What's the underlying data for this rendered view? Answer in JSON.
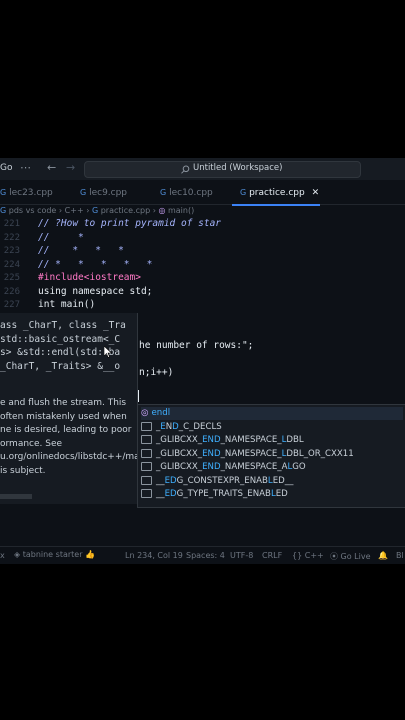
{
  "titlebar": {
    "menu": "Go",
    "more": "⋯",
    "back": "←",
    "forward": "→",
    "search": "Untitled (Workspace)"
  },
  "tabs": [
    {
      "label": "lec23.cpp"
    },
    {
      "label": "lec9.cpp"
    },
    {
      "label": "lec10.cpp"
    },
    {
      "label": "practice.cpp",
      "close": "✕"
    }
  ],
  "breadcrumb": {
    "root": "pds vs code",
    "lang": "C++",
    "file": "practice.cpp",
    "symbol": "main()"
  },
  "code": {
    "line_numbers": [
      "221",
      "222",
      "223",
      "224",
      "225",
      "226",
      "227"
    ],
    "lines": [
      "// ?How to print pyramid of star",
      "//     *",
      "//    *   *   *",
      "// *   *   *   *   *",
      "#include<iostream>",
      "using namespace std;",
      "int main()"
    ],
    "frag1": "he number of rows:\";",
    "frag2": "n;i++)"
  },
  "hover": {
    "sig": [
      "ass _CharT, class _Tra",
      "std::basic_ostream<_C",
      "s> &std::endl(std::ba",
      "_CharT, _Traits> &__o"
    ],
    "doc": [
      "e and flush the stream. This",
      "often mistakenly used when",
      "ne is desired, leading to poor",
      "ormance. See",
      "u.org/onlinedocs/libstdc++/ma",
      "is subject."
    ]
  },
  "suggest": [
    {
      "pre": "",
      "hl": "endl",
      "post": ""
    },
    {
      "pre": "_",
      "hl": "E",
      "mid": "N",
      "hl2": "D",
      "post": "_C_DECLS"
    },
    {
      "pre": "_GLIBCXX_",
      "hl": "END",
      "post": "_NAMESPACE_",
      "hl2": "L",
      "post2": "DBL"
    },
    {
      "pre": "_GLIBCXX_",
      "hl": "END",
      "post": "_NAMESPACE_",
      "hl2": "L",
      "post2": "DBL_OR_CXX11"
    },
    {
      "pre": "_GLIBCXX_",
      "hl": "END",
      "post": "_NAMESPACE_A",
      "hl2": "L",
      "post2": "GO"
    },
    {
      "pre": "__",
      "hl": "ED",
      "post": "G_CONSTEXPR_ENAB",
      "hl2": "L",
      "post2": "ED__"
    },
    {
      "pre": "__",
      "hl": "ED",
      "post": "G_TYPE_TRAITS_ENAB",
      "hl2": "L",
      "post2": "ED"
    }
  ],
  "status": {
    "left": "x",
    "tabnine": "tabnine starter",
    "position": "Ln 234, Col 19",
    "spaces": "Spaces: 4",
    "encoding": "UTF-8",
    "eol": "CRLF",
    "lang": "C++",
    "golive": "Go Live",
    "more": "Bl"
  },
  "colors": {
    "accent": "#3fb0ff",
    "tab_underline": "#3b82f6",
    "keyword": "#ff79c6",
    "comment": "#a5b4fc"
  }
}
